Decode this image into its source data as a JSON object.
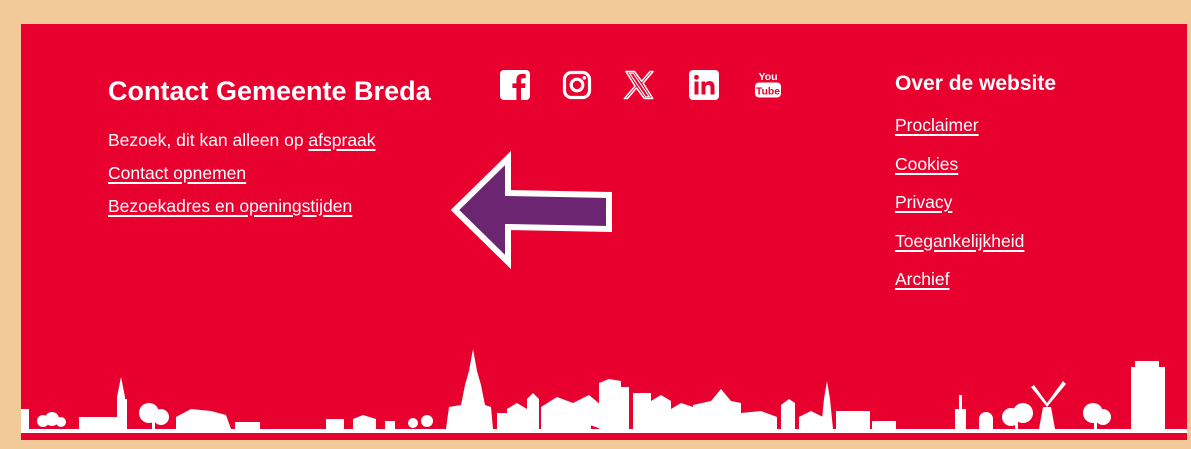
{
  "contact": {
    "title": "Contact Gemeente Breda",
    "visit_text": "Bezoek, dit kan alleen op ",
    "visit_link": "afspraak",
    "links": [
      "Contact opnemen",
      "Bezoekadres en openingstijden"
    ]
  },
  "social": {
    "icons": [
      "facebook-icon",
      "instagram-icon",
      "x-icon",
      "linkedin-icon",
      "youtube-icon"
    ],
    "youtube_text": [
      "You",
      "Tube"
    ]
  },
  "about": {
    "heading": "Over de website",
    "links": [
      "Proclaimer",
      "Cookies",
      "Privacy",
      "Toegankelijkheid",
      "Archief"
    ]
  },
  "colors": {
    "background": "#e8002f",
    "frame": "#f2c998",
    "arrow": "#6b2571",
    "text": "#ffffff"
  }
}
